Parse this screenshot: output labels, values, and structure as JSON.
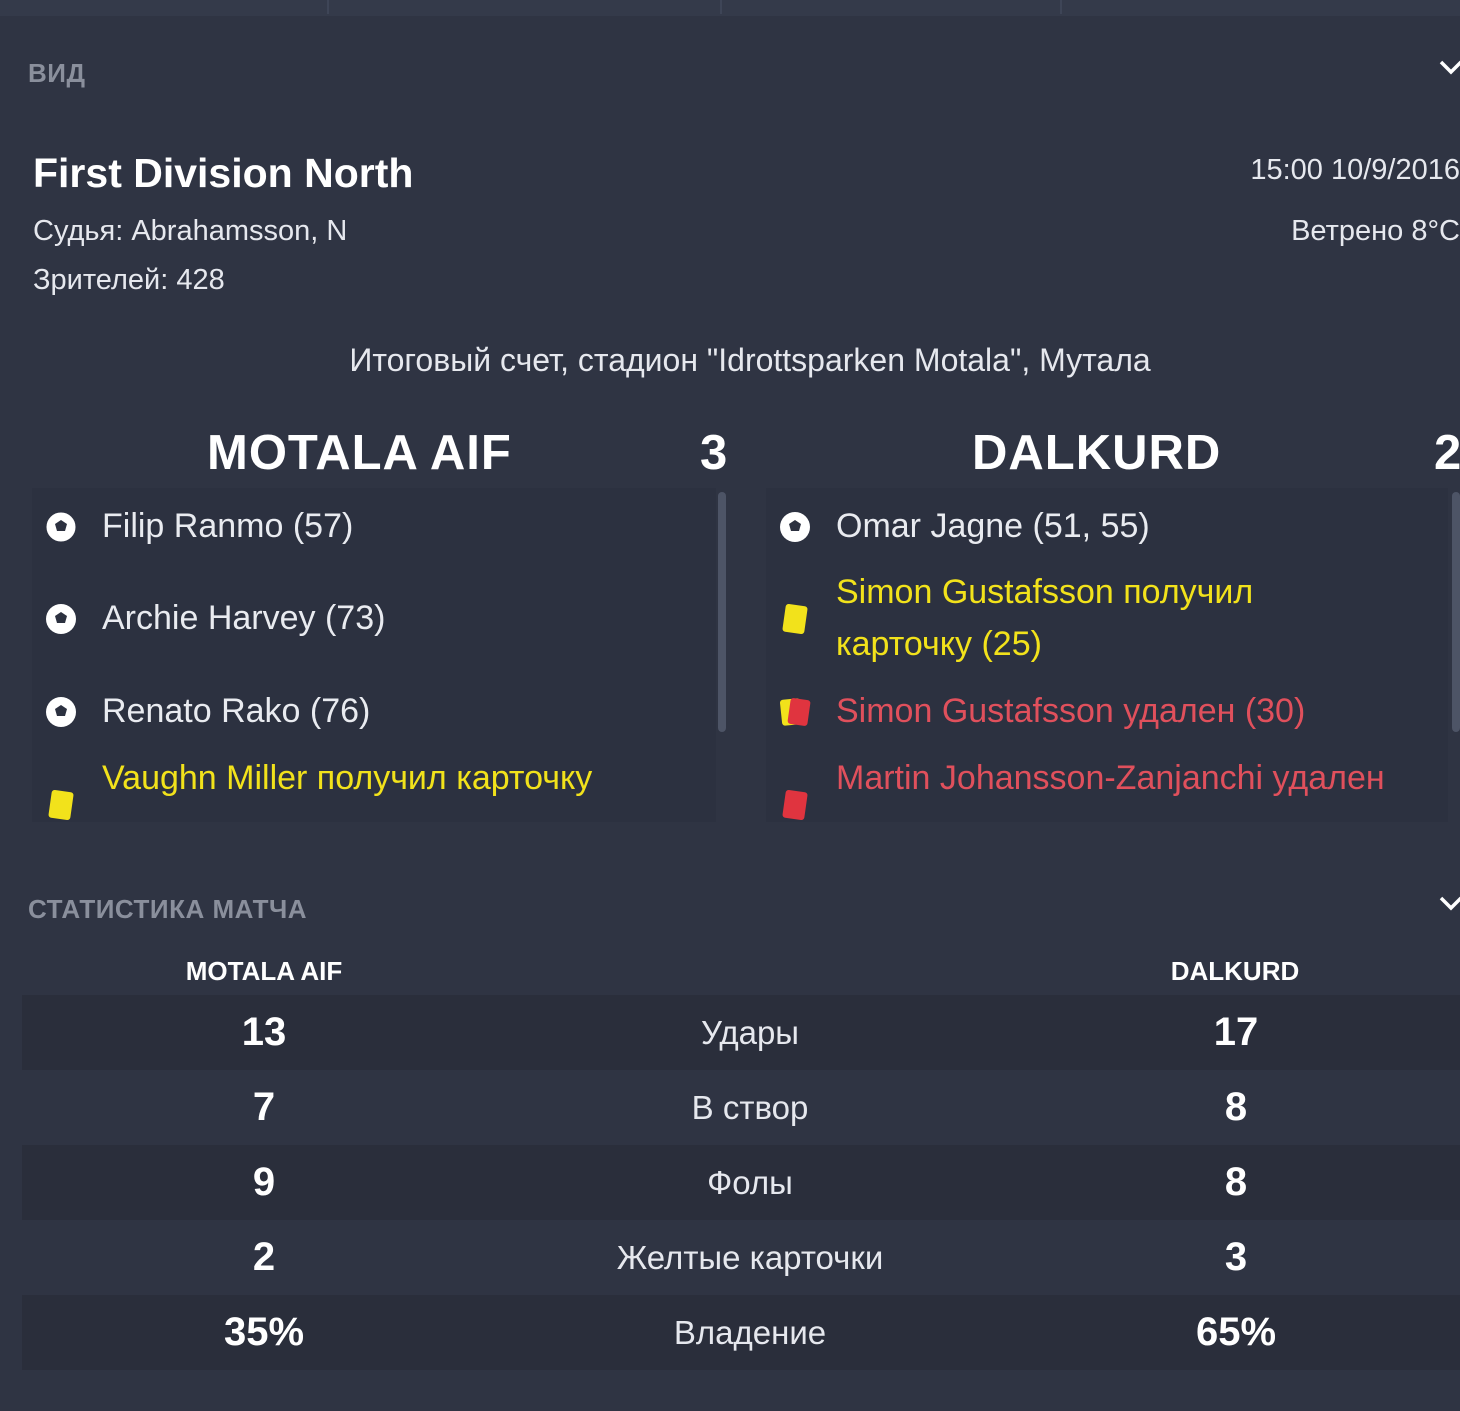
{
  "view_section": {
    "label": "ВИД"
  },
  "match": {
    "competition": "First Division North",
    "referee": "Судья: Abrahamsson, N",
    "attendance": "Зрителей: 428",
    "datetime": "15:00 10/9/2016",
    "weather": "Ветрено 8°C",
    "venue_line": "Итоговый счет, стадион \"Idrottsparken Motala\", Мутала"
  },
  "home": {
    "name": "MOTALA AIF",
    "score": "3",
    "events": [
      {
        "type": "goal",
        "icon": "football-icon",
        "text": "Filip Ranmo (57)"
      },
      {
        "type": "goal",
        "icon": "football-icon",
        "text": "Archie Harvey (73)"
      },
      {
        "type": "goal",
        "icon": "football-icon",
        "text": "Renato Rako (76)"
      },
      {
        "type": "yellow",
        "icon": "yellow-card-icon",
        "text": "Vaughn Miller получил карточку"
      }
    ]
  },
  "away": {
    "name": "DALKURD",
    "score": "2",
    "events": [
      {
        "type": "goal",
        "icon": "football-icon",
        "text": "Omar Jagne (51, 55)"
      },
      {
        "type": "yellow",
        "icon": "yellow-card-icon",
        "text_line1": "Simon Gustafsson получил",
        "text_line2": "карточку (25)"
      },
      {
        "type": "second-yellow",
        "icon": "second-yellow-card-icon",
        "text": "Simon Gustafsson удален (30)"
      },
      {
        "type": "red",
        "icon": "red-card-icon",
        "text": "Martin Johansson-Zanjanchi удален"
      }
    ]
  },
  "stats_section": {
    "label": "СТАТИСТИКА МАТЧА"
  },
  "stats": {
    "home_header": "MOTALA AIF",
    "away_header": "DALKURD",
    "rows": [
      {
        "label": "Удары",
        "home": "13",
        "away": "17"
      },
      {
        "label": "В створ",
        "home": "7",
        "away": "8"
      },
      {
        "label": "Фолы",
        "home": "9",
        "away": "8"
      },
      {
        "label": "Желтые карточки",
        "home": "2",
        "away": "3"
      },
      {
        "label": "Владение",
        "home": "35%",
        "away": "65%"
      }
    ]
  },
  "colors": {
    "background": "#2f3443",
    "yellow_text": "#f2e21b",
    "red_text": "#e0505c"
  }
}
